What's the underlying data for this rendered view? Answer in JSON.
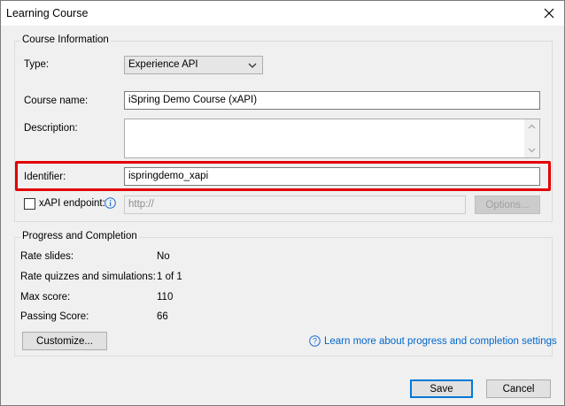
{
  "window": {
    "title": "Learning Course"
  },
  "course_info": {
    "legend": "Course Information",
    "type_label": "Type:",
    "type_value": "Experience API",
    "course_name_label": "Course name:",
    "course_name_value": "iSpring Demo Course (xAPI)",
    "description_label": "Description:",
    "description_value": "",
    "identifier_label": "Identifier:",
    "identifier_value": "ispringdemo_xapi",
    "xapi_endpoint_label": "xAPI endpoint:",
    "xapi_endpoint_placeholder": "http://",
    "xapi_endpoint_checked": false,
    "options_label": "Options..."
  },
  "progress": {
    "legend": "Progress and Completion",
    "rows": [
      {
        "label": "Rate slides:",
        "value": "No"
      },
      {
        "label": "Rate quizzes and simulations:",
        "value": "1 of 1"
      },
      {
        "label": "Max score:",
        "value": "110"
      },
      {
        "label": "Passing Score:",
        "value": "66"
      }
    ],
    "customize_label": "Customize...",
    "learn_more_label": "Learn more about progress and completion settings"
  },
  "footer": {
    "save_label": "Save",
    "cancel_label": "Cancel"
  },
  "colors": {
    "highlight": "#e10000",
    "link": "#0066cc",
    "primary_border": "#0078d7"
  }
}
